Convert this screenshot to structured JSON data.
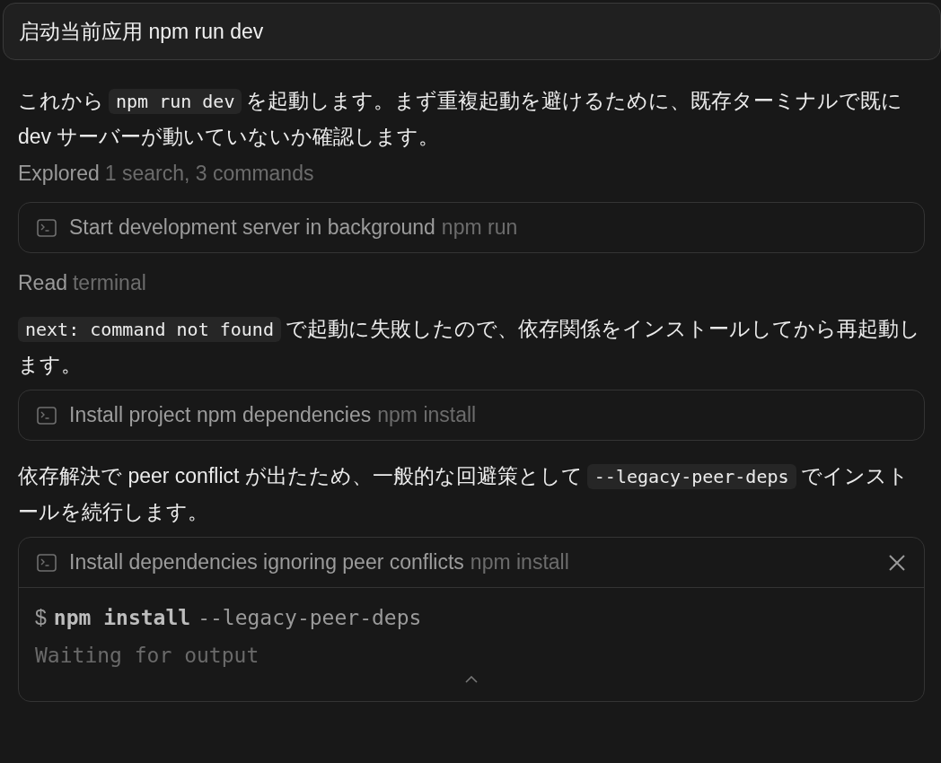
{
  "prompt": {
    "text": "启动当前应用 npm run dev"
  },
  "items": [
    {
      "kind": "paragraph",
      "segments": [
        {
          "kind": "text",
          "text": "これから"
        },
        {
          "kind": "code",
          "text": "npm run dev"
        },
        {
          "kind": "text",
          "text": "を起動します。まず重複起動を避けるために、既存ターミナルで既に dev サーバーが動いていないか確認します。"
        }
      ]
    },
    {
      "kind": "label",
      "title": "Explored",
      "detail": "1 search, 3 commands"
    },
    {
      "kind": "command",
      "title": "Start development server in background",
      "detail": "npm run",
      "expanded": false
    },
    {
      "kind": "label",
      "title": "Read",
      "detail": "terminal"
    },
    {
      "kind": "paragraph",
      "segments": [
        {
          "kind": "code",
          "text": "next: command not found"
        },
        {
          "kind": "text",
          "text": "で起動に失敗したので、依存関係をインストールしてから再起動します。"
        }
      ]
    },
    {
      "kind": "command",
      "title": "Install project npm dependencies",
      "detail": "npm install",
      "expanded": false
    },
    {
      "kind": "paragraph",
      "segments": [
        {
          "kind": "text",
          "text": "依存解決で peer conflict が出たため、一般的な回避策として"
        },
        {
          "kind": "code",
          "text": "--legacy-peer-deps"
        },
        {
          "kind": "text",
          "text": "でインストールを続行します。"
        }
      ]
    },
    {
      "kind": "command",
      "title": "Install dependencies ignoring peer conflicts",
      "detail": "npm install",
      "expanded": true,
      "terminal": {
        "prompt": "$",
        "program": "npm install",
        "args": "--legacy-peer-deps",
        "status": "Waiting for output"
      }
    }
  ]
}
